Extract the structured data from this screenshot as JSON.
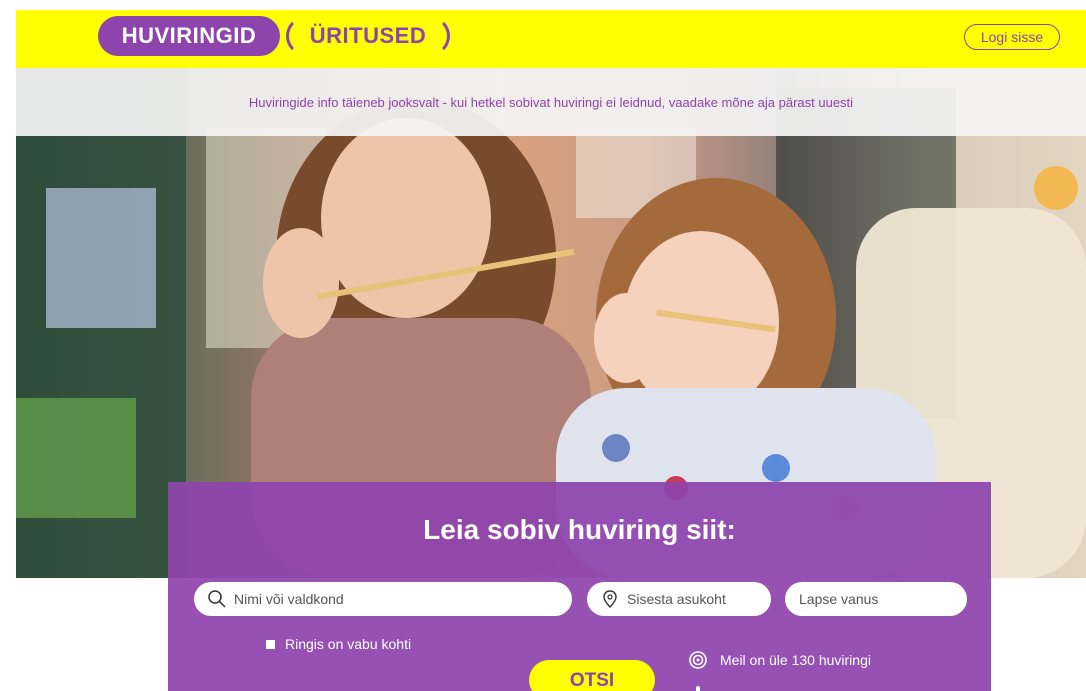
{
  "header": {
    "tab_active": "HUVIRINGID",
    "tab_inactive": "ÜRITUSED",
    "login": "Logi sisse"
  },
  "notice": {
    "text": "Huviringide info täieneb jooksvalt - kui hetkel sobivat huviringi ei leidnud, vaadake mõne aja pärast uuesti"
  },
  "search": {
    "title": "Leia sobiv huviring siit:",
    "name_placeholder": "Nimi või valdkond",
    "location_placeholder": "Sisesta asukoht",
    "age_placeholder": "Lapse vanus",
    "checkbox_label": "Ringis on vabu kohti",
    "submit": "OTSI",
    "stat": "Meil on üle 130 huviringi"
  },
  "colors": {
    "accent": "#8e44ad",
    "yellow": "#ffff00"
  },
  "icons": [
    "search-icon",
    "location-pin-icon",
    "target-icon"
  ]
}
